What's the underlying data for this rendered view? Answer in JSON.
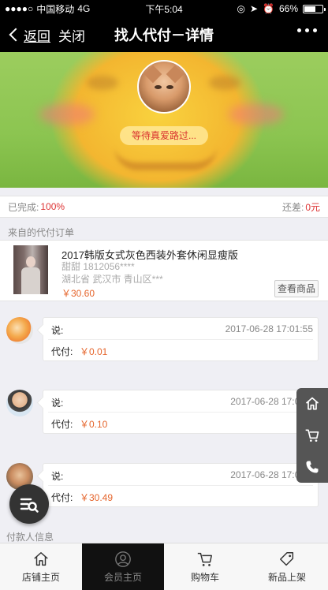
{
  "status_bar": {
    "carrier": "中国移动",
    "network": "4G",
    "time": "下午5:04",
    "battery_text": "66%",
    "battery_level": 0.66,
    "icons": [
      "signal-icon",
      "lock-rotation-icon",
      "location-icon",
      "alarm-icon",
      "battery-icon"
    ]
  },
  "nav": {
    "back_label": "返回",
    "close_label": "关闭",
    "title": "找人代付－详情",
    "more_icon": "more-icon"
  },
  "hero": {
    "status_text": "等待真爱路过..."
  },
  "progress": {
    "completed_label": "已完成:",
    "completed_value": "100%",
    "remaining_label": "还差:",
    "remaining_value": "0元"
  },
  "order": {
    "section_label": "来自的代付订单",
    "title": "2017韩版女式灰色西装外套休闲显瘦版",
    "buyer": "甜甜 1812056****",
    "address": "湖北省 武汉市 青山区***",
    "price": "￥30.60",
    "view_button": "查看商品"
  },
  "payments": [
    {
      "say_label": "说:",
      "time": "2017-06-28 17:01:55",
      "amount_label": "代付:",
      "amount": "￥0.01"
    },
    {
      "say_label": "说:",
      "time": "2017-06-28 17:02:0",
      "amount_label": "代付:",
      "amount": "￥0.10"
    },
    {
      "say_label": "说:",
      "time": "2017-06-28 17:03:1",
      "amount_label": "代付:",
      "amount": "￥30.49"
    }
  ],
  "payer_section_label": "付款人信息",
  "float_toolbar": {
    "icons": [
      "home-icon",
      "cart-icon",
      "phone-icon"
    ]
  },
  "tabbar": {
    "tabs": [
      {
        "label": "店铺主页",
        "icon": "home-icon"
      },
      {
        "label": "会员主页",
        "icon": "member-icon"
      },
      {
        "label": "购物车",
        "icon": "cart-icon"
      },
      {
        "label": "新品上架",
        "icon": "tag-icon"
      }
    ]
  },
  "colors": {
    "accent_red": "#d33333",
    "price_orange": "#e5652c",
    "nav_bg": "#000000",
    "page_bg": "#efeff4"
  }
}
